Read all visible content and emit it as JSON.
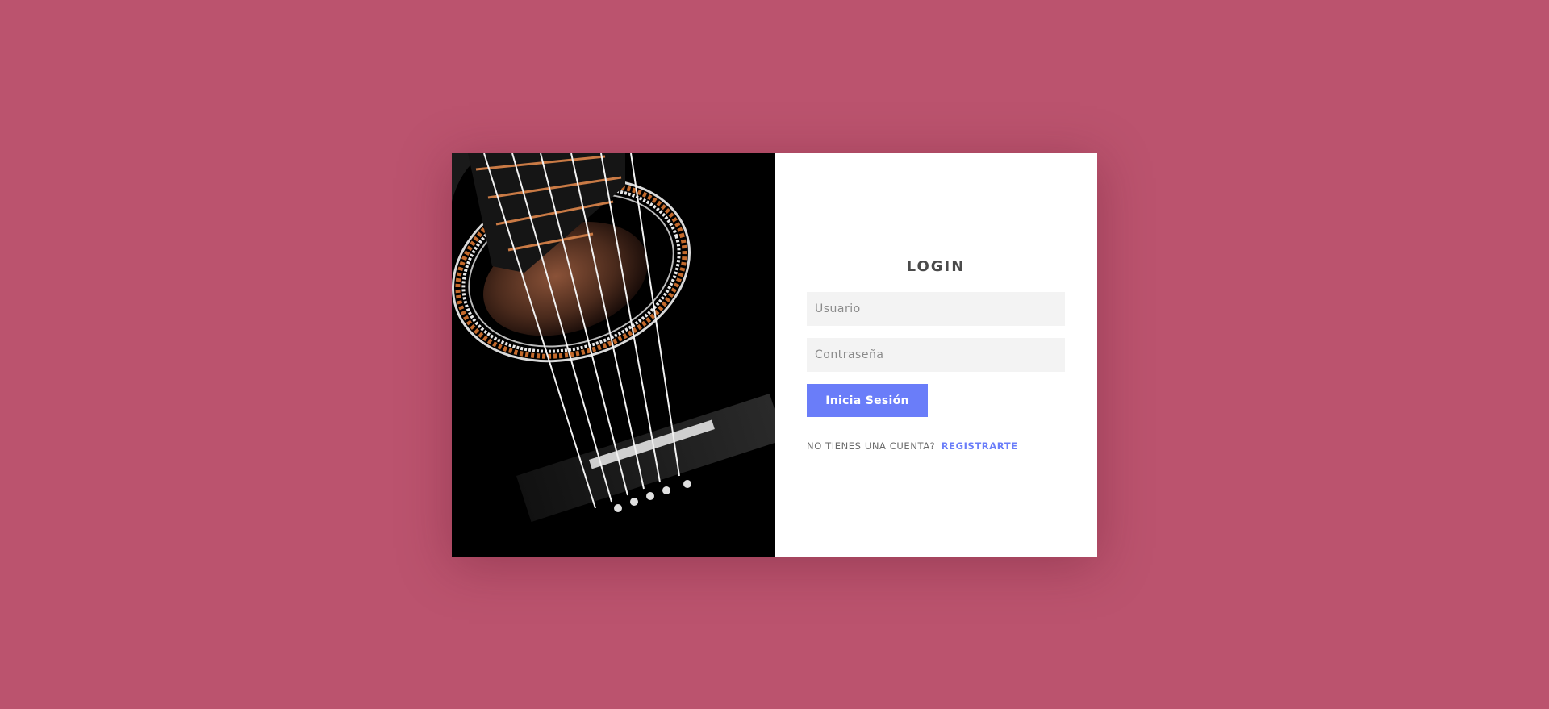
{
  "background_color": "#bb536e",
  "accent_color": "#6a7df9",
  "image": {
    "icon": "acoustic-guitar-photo"
  },
  "login": {
    "title": "LOGIN",
    "username_placeholder": "Usuario",
    "password_placeholder": "Contraseña",
    "submit_label": "Inicia Sesión",
    "signup_prompt": "NO TIENES UNA CUENTA?",
    "signup_link": "REGISTRARTE"
  }
}
